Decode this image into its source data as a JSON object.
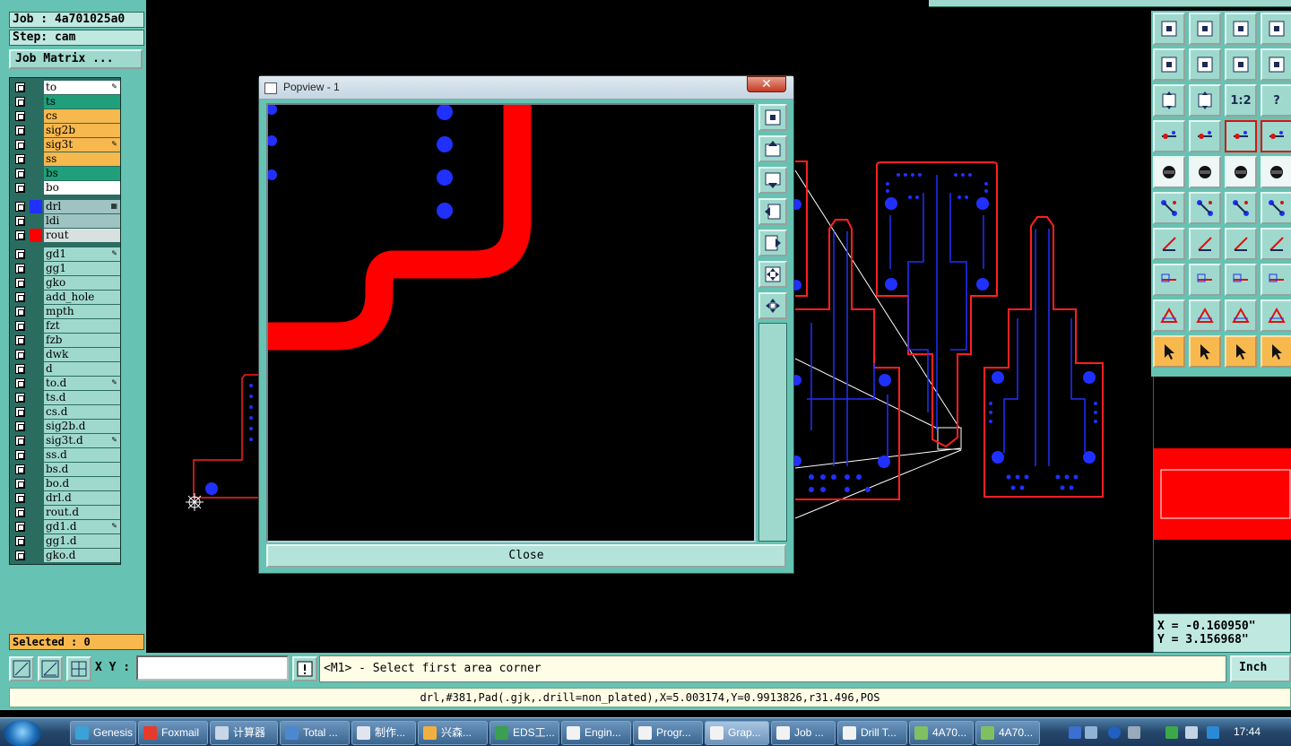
{
  "job": {
    "label": "Job : 4a701025a0",
    "step": "Step: cam",
    "matrix_button": "Job Matrix ..."
  },
  "layers": [
    {
      "name": "to",
      "bg": "#ffffff",
      "mark": "pen"
    },
    {
      "name": "ts",
      "bg": "#1fa07a",
      "mark": ""
    },
    {
      "name": "cs",
      "bg": "#f7b84e",
      "mark": ""
    },
    {
      "name": "sig2b",
      "bg": "#f7b84e",
      "mark": ""
    },
    {
      "name": "sig3t",
      "bg": "#f7b84e",
      "mark": "pen"
    },
    {
      "name": "ss",
      "bg": "#f7b84e",
      "mark": ""
    },
    {
      "name": "bs",
      "bg": "#1fa07a",
      "mark": ""
    },
    {
      "name": "bo",
      "bg": "#ffffff",
      "mark": ""
    },
    {
      "name": "drl",
      "bg": "#9fc3c3",
      "mark": "grid",
      "swatch": "#2030ff"
    },
    {
      "name": "ldi",
      "bg": "#9fc3c3",
      "mark": ""
    },
    {
      "name": "rout",
      "bg": "#d8e0e0",
      "mark": "",
      "swatch": "#ff0000"
    },
    {
      "name": "gd1",
      "bg": "#9fd9cd",
      "mark": "pen"
    },
    {
      "name": "gg1",
      "bg": "#9fd9cd",
      "mark": ""
    },
    {
      "name": "gko",
      "bg": "#9fd9cd",
      "mark": ""
    },
    {
      "name": "add_hole",
      "bg": "#9fd9cd",
      "mark": ""
    },
    {
      "name": "mpth",
      "bg": "#9fd9cd",
      "mark": ""
    },
    {
      "name": "fzt",
      "bg": "#9fd9cd",
      "mark": ""
    },
    {
      "name": "fzb",
      "bg": "#9fd9cd",
      "mark": ""
    },
    {
      "name": "dwk",
      "bg": "#9fd9cd",
      "mark": ""
    },
    {
      "name": "d",
      "bg": "#9fd9cd",
      "mark": ""
    },
    {
      "name": "to.d",
      "bg": "#9fd9cd",
      "mark": "pen"
    },
    {
      "name": "ts.d",
      "bg": "#9fd9cd",
      "mark": ""
    },
    {
      "name": "cs.d",
      "bg": "#9fd9cd",
      "mark": ""
    },
    {
      "name": "sig2b.d",
      "bg": "#9fd9cd",
      "mark": ""
    },
    {
      "name": "sig3t.d",
      "bg": "#9fd9cd",
      "mark": "pen"
    },
    {
      "name": "ss.d",
      "bg": "#9fd9cd",
      "mark": ""
    },
    {
      "name": "bs.d",
      "bg": "#9fd9cd",
      "mark": ""
    },
    {
      "name": "bo.d",
      "bg": "#9fd9cd",
      "mark": ""
    },
    {
      "name": "drl.d",
      "bg": "#9fd9cd",
      "mark": ""
    },
    {
      "name": "rout.d",
      "bg": "#9fd9cd",
      "mark": ""
    },
    {
      "name": "gd1.d",
      "bg": "#9fd9cd",
      "mark": "pen"
    },
    {
      "name": "gg1.d",
      "bg": "#9fd9cd",
      "mark": ""
    },
    {
      "name": "gko.d",
      "bg": "#9fd9cd",
      "mark": ""
    }
  ],
  "selected": "Selected : 0",
  "popview": {
    "title": "Popview - 1",
    "close_x": "✕",
    "close_button": "Close"
  },
  "toolbar": {
    "ratio_label": "1:2",
    "help_label": "?"
  },
  "coords": {
    "x": "X = -0.160950\"",
    "y": "Y = 3.156968\""
  },
  "command": {
    "xy_label": "X Y :",
    "xy_value": "",
    "prompt": "<M1> - Select first area corner",
    "units": "Inch"
  },
  "status": "drl,#381,Pad(.gjk,.drill=non_plated),X=5.003174,Y=0.9913826,r31.496,POS",
  "taskbar": {
    "items": [
      {
        "label": "Genesis",
        "color": "#3aa2d8"
      },
      {
        "label": "Foxmail",
        "color": "#e83a2a"
      },
      {
        "label": "计算器",
        "color": "#c8d6e6"
      },
      {
        "label": "Total ...",
        "color": "#4c88d0"
      },
      {
        "label": "制作...",
        "color": "#e0e6f0"
      },
      {
        "label": "兴森...",
        "color": "#f0b040"
      },
      {
        "label": "EDS工...",
        "color": "#3aa050"
      },
      {
        "label": "Engin...",
        "color": "#f2f2f2"
      },
      {
        "label": "Progr...",
        "color": "#f2f2f2"
      },
      {
        "label": "Grap...",
        "color": "#f2f2f2"
      },
      {
        "label": "Job ...",
        "color": "#f2f2f2"
      },
      {
        "label": "Drill T...",
        "color": "#f2f2f2"
      },
      {
        "label": "4A70...",
        "color": "#80c060"
      },
      {
        "label": "4A70...",
        "color": "#80c060"
      }
    ],
    "active_index": 9,
    "clock": "17:44"
  },
  "colors": {
    "panel": "#66c2b2",
    "pad": "#1a1aff",
    "rout": "#ff0000",
    "warn": "#f7b84e"
  }
}
